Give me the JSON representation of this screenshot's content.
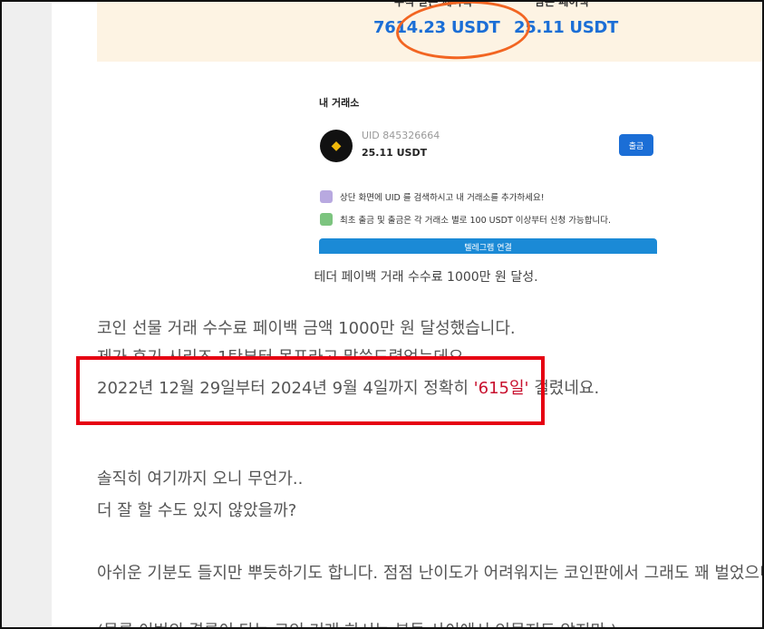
{
  "banner": {
    "cumulative_label": "누적 받은 페이백",
    "cumulative_value": "7614.23 USDT",
    "remaining_label": "남은 페이백",
    "remaining_value": "25.11 USDT"
  },
  "card": {
    "title": "내 거래소",
    "uid": "UID 845326664",
    "balance": "25.11 USDT",
    "withdraw_label": "출금",
    "note1": "상단 화면에 UID 를 검색하시고 내 거래소를 추가하세요!",
    "note2": "최초 출금 및 출금은 각 거래소 별로 100 USDT 이상부터 신청 가능합니다.",
    "telegram_label": "텔레그램 연결"
  },
  "caption": "테더 페이백 거래 수수료 1000만 원 달성.",
  "paragraphs": {
    "p1": "코인 선물 거래 수수료 페이백 금액 1000만 원 달성했습니다.",
    "p2": "제가 후기 시리즈 1탄부터 목표라고 말씀드렸었는데요.",
    "p3_before": "2022년 12월 29일부터 2024년 9월 4일까지 정확히 ",
    "p3_highlight": "'615일'",
    "p3_after": " 걸렸네요.",
    "p4": "솔직히 여기까지 오니 무언가..",
    "p5": "더 잘 할 수도 있지 않았을까?",
    "p6": "아쉬운 기분도 들지만 뿌듯하기도 합니다. 점점 난이도가 어려워지는 코인판에서 그래도 꽤 벌었으니까요.",
    "p7": "(물론 이번의 결론이 다는 코인 거래 하시는 분들 사이에서 인물지도 않지만.)"
  },
  "colors": {
    "accent": "#1b6ed6",
    "highlight": "#c8102e",
    "annotation_circle": "#f26522",
    "annotation_box": "#e60012"
  }
}
